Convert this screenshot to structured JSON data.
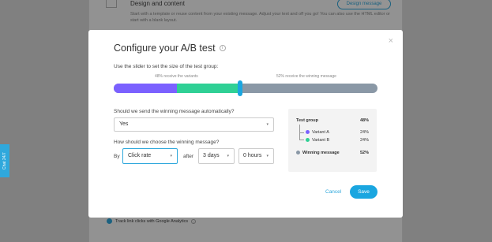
{
  "background": {
    "section_title": "Design and content",
    "section_desc": "Start with a template or reuse content from your existing message. Adjust your text and off you go! You can also use the HTML editor or start with a blank layout.",
    "design_button": "Design message",
    "track_label": "Track link clicks with Google Analytics",
    "info_glyph": "i",
    "chat_tab": "Chat 24/7"
  },
  "modal": {
    "title": "Configure your A/B test",
    "title_info": "i",
    "close": "×",
    "slider_label": "Use the slider to set the size of the test group:",
    "variants_label": "48% receive the variants",
    "winning_label": "52% receive the winning message",
    "slider": {
      "variant_a_pct": 24,
      "variant_b_pct": 24,
      "winning_pct": 52,
      "colors": {
        "variant_a": "#7b61ff",
        "variant_b": "#2fd095",
        "winning": "#8a98a6",
        "thumb": "#1aa6e0"
      }
    },
    "question_auto": "Should we send the winning message automatically?",
    "auto_value": "Yes",
    "question_choose": "How should we choose the winning message?",
    "by_label": "By",
    "criterion_value": "Click rate",
    "after_label": "after",
    "days_value": "3 days",
    "hours_value": "0 hours",
    "caret": "▾",
    "summary": {
      "test_group_label": "Test group",
      "test_group_value": "48%",
      "variant_a_label": "Variant A",
      "variant_a_value": "24%",
      "variant_b_label": "Variant B",
      "variant_b_value": "24%",
      "winning_label": "Winning message",
      "winning_value": "52%"
    },
    "cancel": "Cancel",
    "save": "Save"
  }
}
